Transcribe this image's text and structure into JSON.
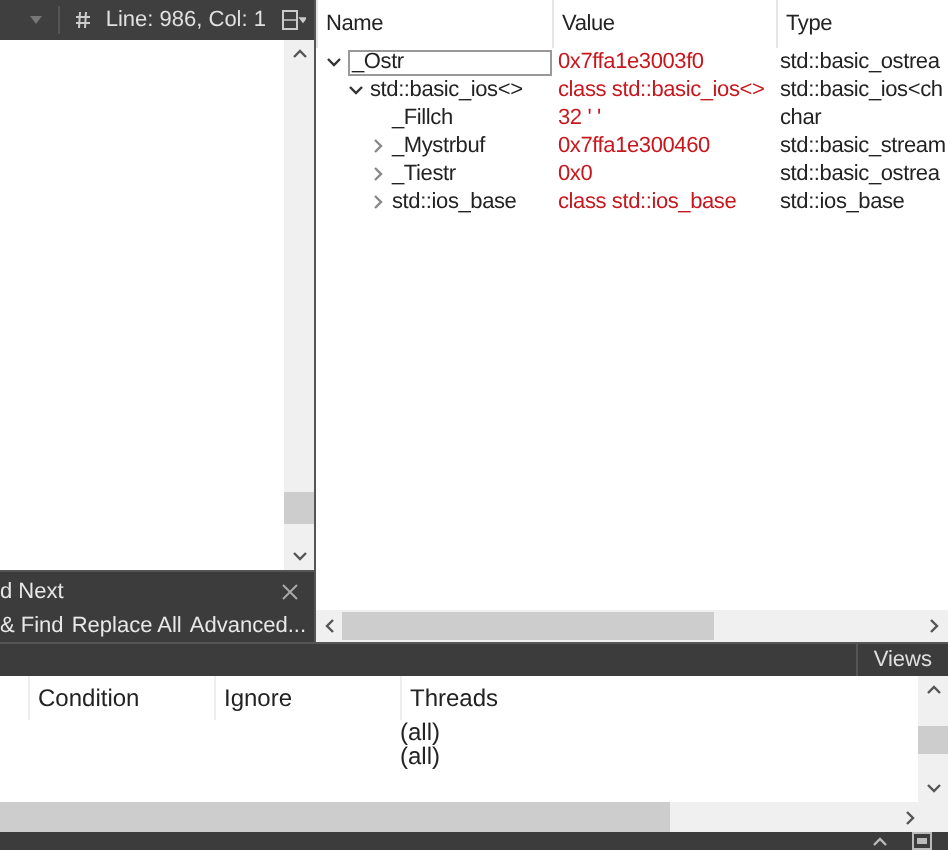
{
  "editor": {
    "status": "Line: 986, Col: 1"
  },
  "find_bar": {
    "title": "d Next",
    "buttons": [
      "& Find",
      "Replace All",
      "Advanced..."
    ]
  },
  "watch": {
    "columns": [
      "Name",
      "Value",
      "Type"
    ],
    "rows": [
      {
        "name": "_Ostr",
        "value": "0x7ffa1e3003f0",
        "type": "std::basic_ostrea",
        "selected": true,
        "expanded": true,
        "children": [
          {
            "name": "std::basic_ios<>",
            "value": "class std::basic_ios<>",
            "type": "std::basic_ios<ch",
            "selected": false,
            "expanded": true,
            "children": [
              {
                "name": "_Fillch",
                "value": "32 ' '",
                "type": "char",
                "selected": false
              },
              {
                "name": "_Mystrbuf",
                "value": "0x7ffa1e300460",
                "type": "std::basic_stream",
                "selected": false,
                "expanded": false
              },
              {
                "name": "_Tiestr",
                "value": "0x0",
                "type": "std::basic_ostrea",
                "selected": false,
                "expanded": false
              },
              {
                "name": "std::ios_base",
                "value": "class std::ios_base",
                "type": "std::ios_base",
                "selected": false,
                "expanded": false
              }
            ]
          }
        ]
      }
    ]
  },
  "panel_bar": {
    "button": "Views"
  },
  "breakpoints": {
    "columns": [
      "Condition",
      "Ignore",
      "Threads"
    ],
    "rows": [
      {
        "threads": "(all)"
      },
      {
        "threads": "(all)"
      }
    ]
  }
}
